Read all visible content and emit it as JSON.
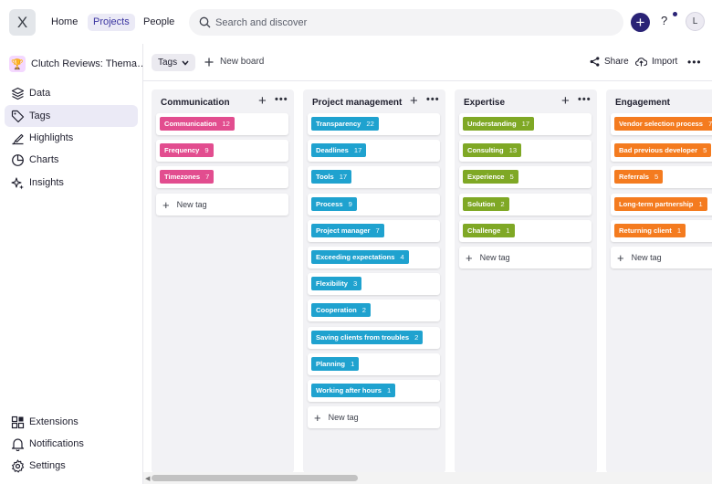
{
  "app": {
    "logo": "X"
  },
  "topnav": {
    "home": "Home",
    "projects": "Projects",
    "people": "People"
  },
  "search": {
    "placeholder": "Search and discover"
  },
  "header_actions": {
    "add": "+",
    "help": "?",
    "avatar": "L"
  },
  "sidebar": {
    "project_name": "Clutch Reviews: Thema…",
    "items": [
      {
        "label": "Data",
        "icon": "layers-icon"
      },
      {
        "label": "Tags",
        "icon": "tag-icon"
      },
      {
        "label": "Highlights",
        "icon": "highlighter-icon"
      },
      {
        "label": "Charts",
        "icon": "pie-chart-icon"
      },
      {
        "label": "Insights",
        "icon": "sparkles-icon"
      }
    ],
    "bottom_items": [
      {
        "label": "Extensions",
        "icon": "extensions-icon"
      },
      {
        "label": "Notifications",
        "icon": "bell-icon"
      },
      {
        "label": "Settings",
        "icon": "gear-icon"
      }
    ]
  },
  "toolbar": {
    "view_select": "Tags",
    "new_board": "New board",
    "share": "Share",
    "import": "Import"
  },
  "board": {
    "new_tag_label": "New tag",
    "columns": [
      {
        "title": "Communication",
        "color": "#e24d8f",
        "tags": [
          {
            "name": "Communication",
            "count": "12"
          },
          {
            "name": "Frequency",
            "count": "9"
          },
          {
            "name": "Timezones",
            "count": "7"
          }
        ]
      },
      {
        "title": "Project management",
        "color": "#1fa2cf",
        "tags": [
          {
            "name": "Transparency",
            "count": "22"
          },
          {
            "name": "Deadlines",
            "count": "17"
          },
          {
            "name": "Tools",
            "count": "17"
          },
          {
            "name": "Process",
            "count": "9"
          },
          {
            "name": "Project manager",
            "count": "7"
          },
          {
            "name": "Exceeding expectations",
            "count": "4"
          },
          {
            "name": "Flexibility",
            "count": "3"
          },
          {
            "name": "Cooperation",
            "count": "2"
          },
          {
            "name": "Saving clients from troubles",
            "count": "2"
          },
          {
            "name": "Planning",
            "count": "1"
          },
          {
            "name": "Working after hours",
            "count": "1"
          }
        ]
      },
      {
        "title": "Expertise",
        "color": "#7fa825",
        "tags": [
          {
            "name": "Understanding",
            "count": "17"
          },
          {
            "name": "Consulting",
            "count": "13"
          },
          {
            "name": "Experience",
            "count": "5"
          },
          {
            "name": "Solution",
            "count": "2"
          },
          {
            "name": "Challenge",
            "count": "1"
          }
        ]
      },
      {
        "title": "Engagement",
        "color": "#f47b1f",
        "tags": [
          {
            "name": "Vendor selection process",
            "count": "7"
          },
          {
            "name": "Bad previous developer",
            "count": "5"
          },
          {
            "name": "Referrals",
            "count": "5"
          },
          {
            "name": "Long-term partnership",
            "count": "1"
          },
          {
            "name": "Returning client",
            "count": "1"
          }
        ]
      }
    ]
  }
}
